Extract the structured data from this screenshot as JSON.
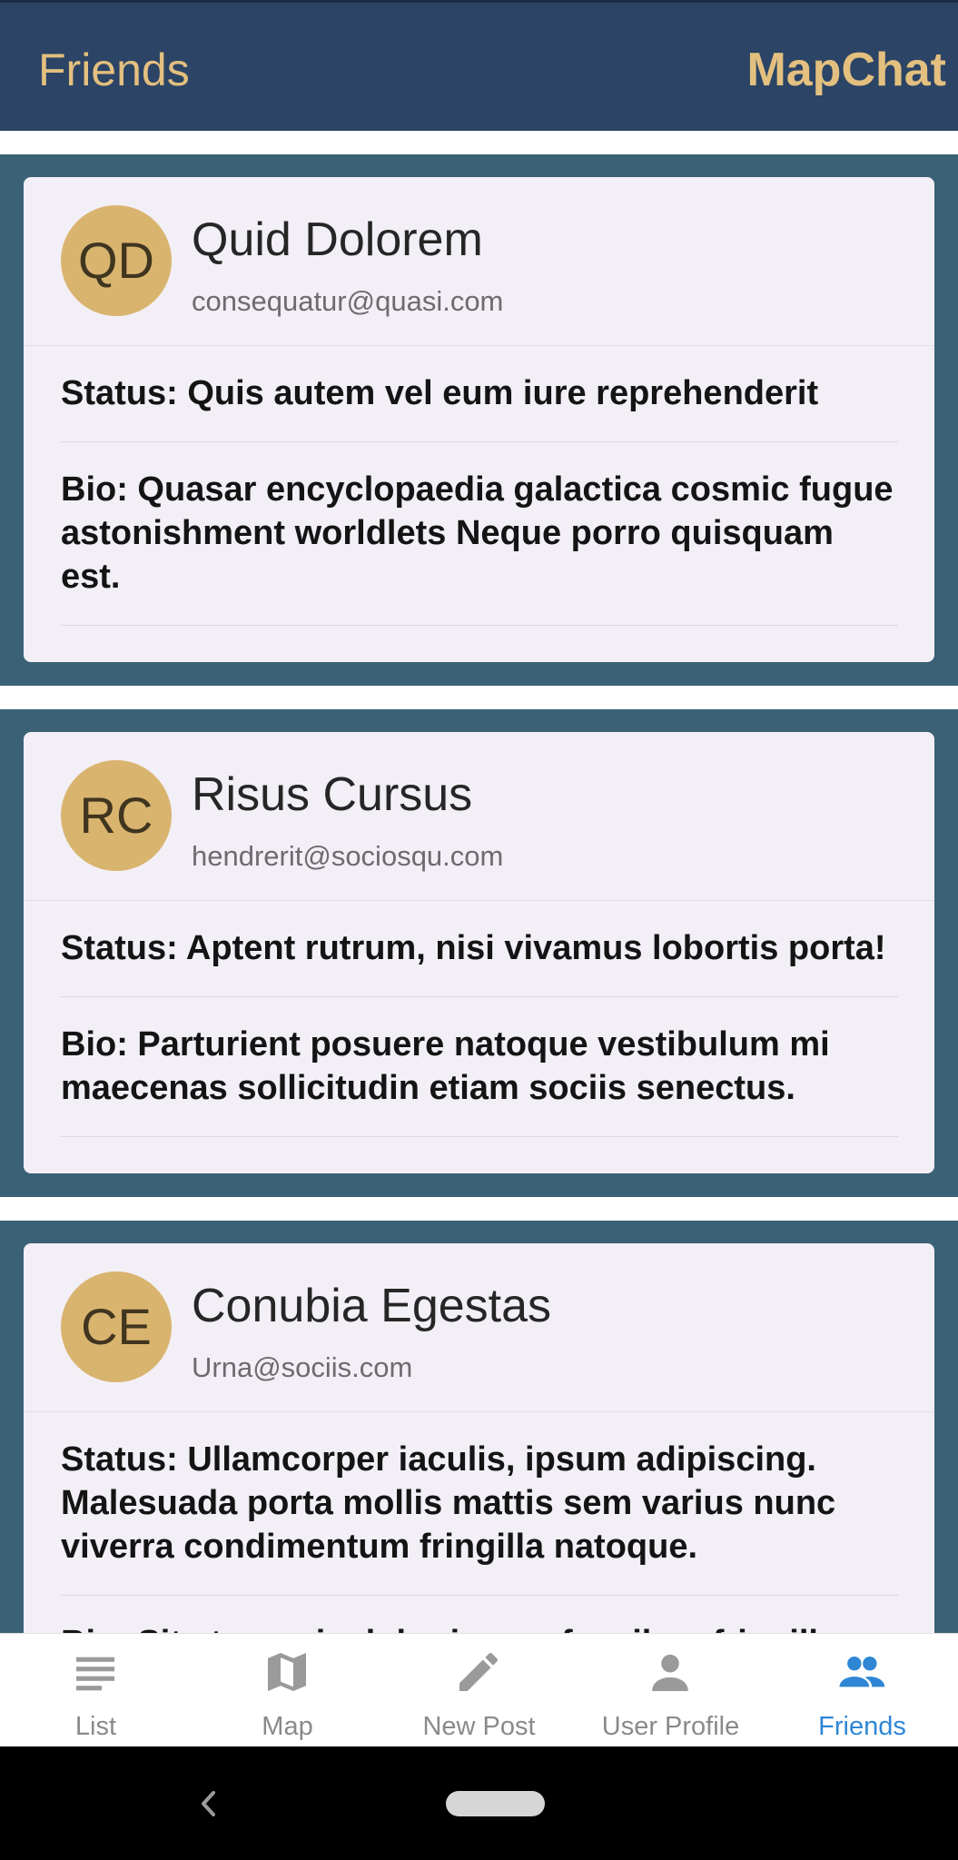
{
  "header": {
    "title": "Friends",
    "app_name": "MapChat"
  },
  "friends": [
    {
      "initials": "QD",
      "name": "Quid Dolorem",
      "email": "consequatur@quasi.com",
      "status": "Status: Quis autem vel eum iure reprehenderit",
      "bio": "Bio: Quasar encyclopaedia galactica cosmic fugue astonishment worldlets Neque porro quisquam est."
    },
    {
      "initials": "RC",
      "name": "Risus Cursus",
      "email": "hendrerit@sociosqu.com",
      "status": "Status: Aptent rutrum, nisi vivamus lobortis porta!",
      "bio": "Bio: Parturient posuere natoque vestibulum mi maecenas sollicitudin etiam sociis senectus."
    },
    {
      "initials": "CE",
      "name": "Conubia Egestas",
      "email": "Urna@sociis.com",
      "status": "Status: Ullamcorper iaculis, ipsum adipiscing. Malesuada porta mollis mattis sem varius nunc viverra condimentum fringilla natoque.",
      "bio": "Bio: Sit at mauris dolor ipsum faucibus fringilla"
    }
  ],
  "nav": {
    "items": [
      {
        "label": "List",
        "icon": "list-icon"
      },
      {
        "label": "Map",
        "icon": "map-icon"
      },
      {
        "label": "New Post",
        "icon": "pencil-icon"
      },
      {
        "label": "User Profile",
        "icon": "person-icon"
      },
      {
        "label": "Friends",
        "icon": "people-icon",
        "active": true
      }
    ]
  },
  "colors": {
    "header_bg": "#2c4465",
    "header_text": "#e3c07f",
    "tile_bg": "#3a6176",
    "card_bg": "#f3eff6",
    "avatar_bg": "#d9b46f",
    "nav_active": "#2f86d4",
    "nav_inactive": "#9a9a9a"
  }
}
